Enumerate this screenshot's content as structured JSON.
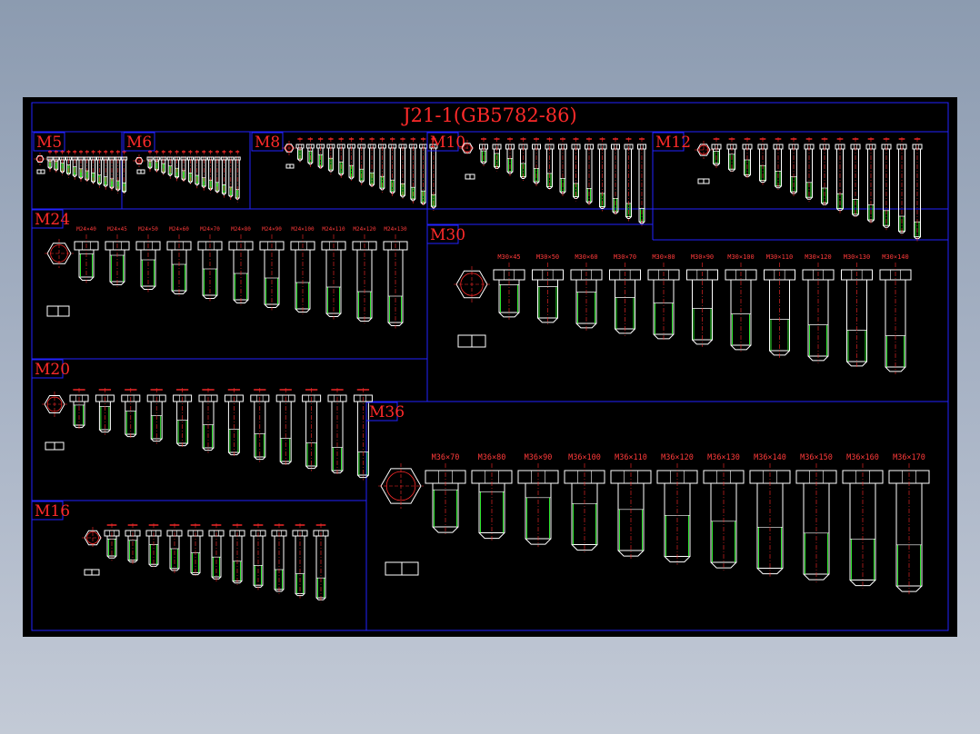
{
  "title": "J21-1(GB5782-86)",
  "sections": [
    {
      "id": "M5",
      "label": "M5",
      "items": [
        "",
        "",
        "",
        "",
        "",
        "",
        "",
        "",
        "",
        "",
        "",
        "",
        ""
      ]
    },
    {
      "id": "M6",
      "label": "M6",
      "items": [
        "",
        "",
        "",
        "",
        "",
        "",
        "",
        "",
        "",
        "",
        "",
        "",
        "",
        ""
      ]
    },
    {
      "id": "M8",
      "label": "M8",
      "items": [
        "",
        "",
        "",
        "",
        "",
        "",
        "",
        "",
        "",
        "",
        "",
        "",
        "",
        ""
      ]
    },
    {
      "id": "M10",
      "label": "M10",
      "items": [
        "",
        "",
        "",
        "",
        "",
        "",
        "",
        "",
        "",
        "",
        "",
        "",
        ""
      ]
    },
    {
      "id": "M12",
      "label": "M12",
      "items": [
        "",
        "",
        "",
        "",
        "",
        "",
        "",
        "",
        "",
        "",
        "",
        "",
        "",
        ""
      ]
    },
    {
      "id": "M24",
      "label": "M24",
      "items": [
        "M24×40",
        "M24×45",
        "M24×50",
        "M24×60",
        "M24×70",
        "M24×80",
        "M24×90",
        "M24×100",
        "M24×110",
        "M24×120",
        "M24×130"
      ]
    },
    {
      "id": "M30",
      "label": "M30",
      "items": [
        "M30×45",
        "M30×50",
        "M30×60",
        "M30×70",
        "M30×80",
        "M30×90",
        "M30×100",
        "M30×110",
        "M30×120",
        "M30×130",
        "M30×140"
      ]
    },
    {
      "id": "M20",
      "label": "M20",
      "items": [
        "",
        "",
        "",
        "",
        "",
        "",
        "",
        "",
        "",
        "",
        "",
        ""
      ]
    },
    {
      "id": "M36",
      "label": "M36",
      "items": [
        "M36×70",
        "M36×80",
        "M36×90",
        "M36×100",
        "M36×110",
        "M36×120",
        "M36×130",
        "M36×140",
        "M36×150",
        "M36×160",
        "M36×170"
      ]
    },
    {
      "id": "M16",
      "label": "M16",
      "items": [
        "",
        "",
        "",
        "",
        "",
        "",
        "",
        "",
        "",
        "",
        ""
      ]
    }
  ]
}
